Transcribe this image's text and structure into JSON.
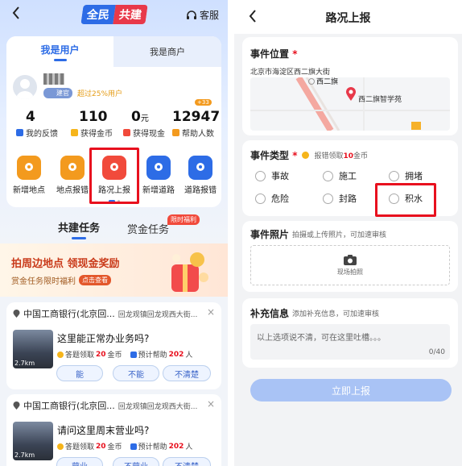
{
  "left": {
    "header": {
      "back_icon": "chevron-left",
      "logo_part1": "全民",
      "logo_part2": "共建",
      "service_label": "客服"
    },
    "tabs": {
      "user": "我是用户",
      "merchant": "我是商户"
    },
    "profile": {
      "badge": "建官",
      "rank_text": "超过25%用户"
    },
    "stats": [
      {
        "value": "4",
        "label": "我的反馈"
      },
      {
        "value": "110",
        "label": "获得金币"
      },
      {
        "value": "0",
        "unit": "元",
        "label": "获得现金"
      },
      {
        "value": "12947",
        "label": "帮助人数",
        "badge": "+33"
      }
    ],
    "actions": [
      {
        "label": "新增地点",
        "icon": "add-place-icon"
      },
      {
        "label": "地点报错",
        "icon": "place-error-icon"
      },
      {
        "label": "路况上报",
        "icon": "car-icon"
      },
      {
        "label": "新增道路",
        "icon": "add-road-icon"
      },
      {
        "label": "道路报错",
        "icon": "road-error-icon"
      }
    ],
    "task_tabs": {
      "build": "共建任务",
      "bounty": "赏金任务",
      "bounty_badge": "限时福利"
    },
    "banner": {
      "title": "拍周边地点 领现金奖励",
      "subtitle": "赏金任务限时福利",
      "button": "点击查看"
    },
    "tasks": [
      {
        "place": "中国工商银行(北京回...",
        "address": "回龙观镇回龙观西大街...",
        "question": "这里能正常办业务吗?",
        "reward_prefix": "答题领取",
        "reward_value": "20",
        "reward_suffix": "金币",
        "help_prefix": "预计帮助",
        "help_value": "202",
        "help_suffix": "人",
        "distance": "2.7km",
        "answers": [
          "能",
          "不能",
          "不清楚"
        ]
      },
      {
        "place": "中国工商银行(北京回...",
        "address": "回龙观镇回龙观西大街...",
        "question": "请问这里周末营业吗?",
        "reward_prefix": "答题领取",
        "reward_value": "20",
        "reward_suffix": "金币",
        "help_prefix": "预计帮助",
        "help_value": "202",
        "help_suffix": "人",
        "distance": "2.7km",
        "answers": [
          "营业",
          "不营业",
          "不清楚"
        ]
      }
    ]
  },
  "right": {
    "header": {
      "title": "路况上报"
    },
    "location": {
      "label": "事件位置",
      "address": "北京市海淀区西二旗大街",
      "map_labels": [
        "西二旗",
        "西二旗智学苑"
      ]
    },
    "event_type": {
      "label": "事件类型",
      "reward_prefix": "报错领取",
      "reward_value": "10",
      "reward_suffix": "金币",
      "options": [
        "事故",
        "施工",
        "拥堵",
        "危险",
        "封路",
        "积水"
      ]
    },
    "photo": {
      "label": "事件照片",
      "hint": "拍摄或上传照片，可加速审核",
      "button": "现场拍照"
    },
    "extra": {
      "label": "补充信息",
      "hint": "添加补充信息，可加速审核",
      "placeholder": "以上选项说不清，可在这里吐槽。。。",
      "counter": "0/40"
    },
    "submit": "立即上报"
  },
  "colors": {
    "accent": "#3a6ee8",
    "highlight": "#e8101e",
    "orange": "#f39a1e",
    "gold": "#f6b51b",
    "submit": "#a9c3f5"
  }
}
